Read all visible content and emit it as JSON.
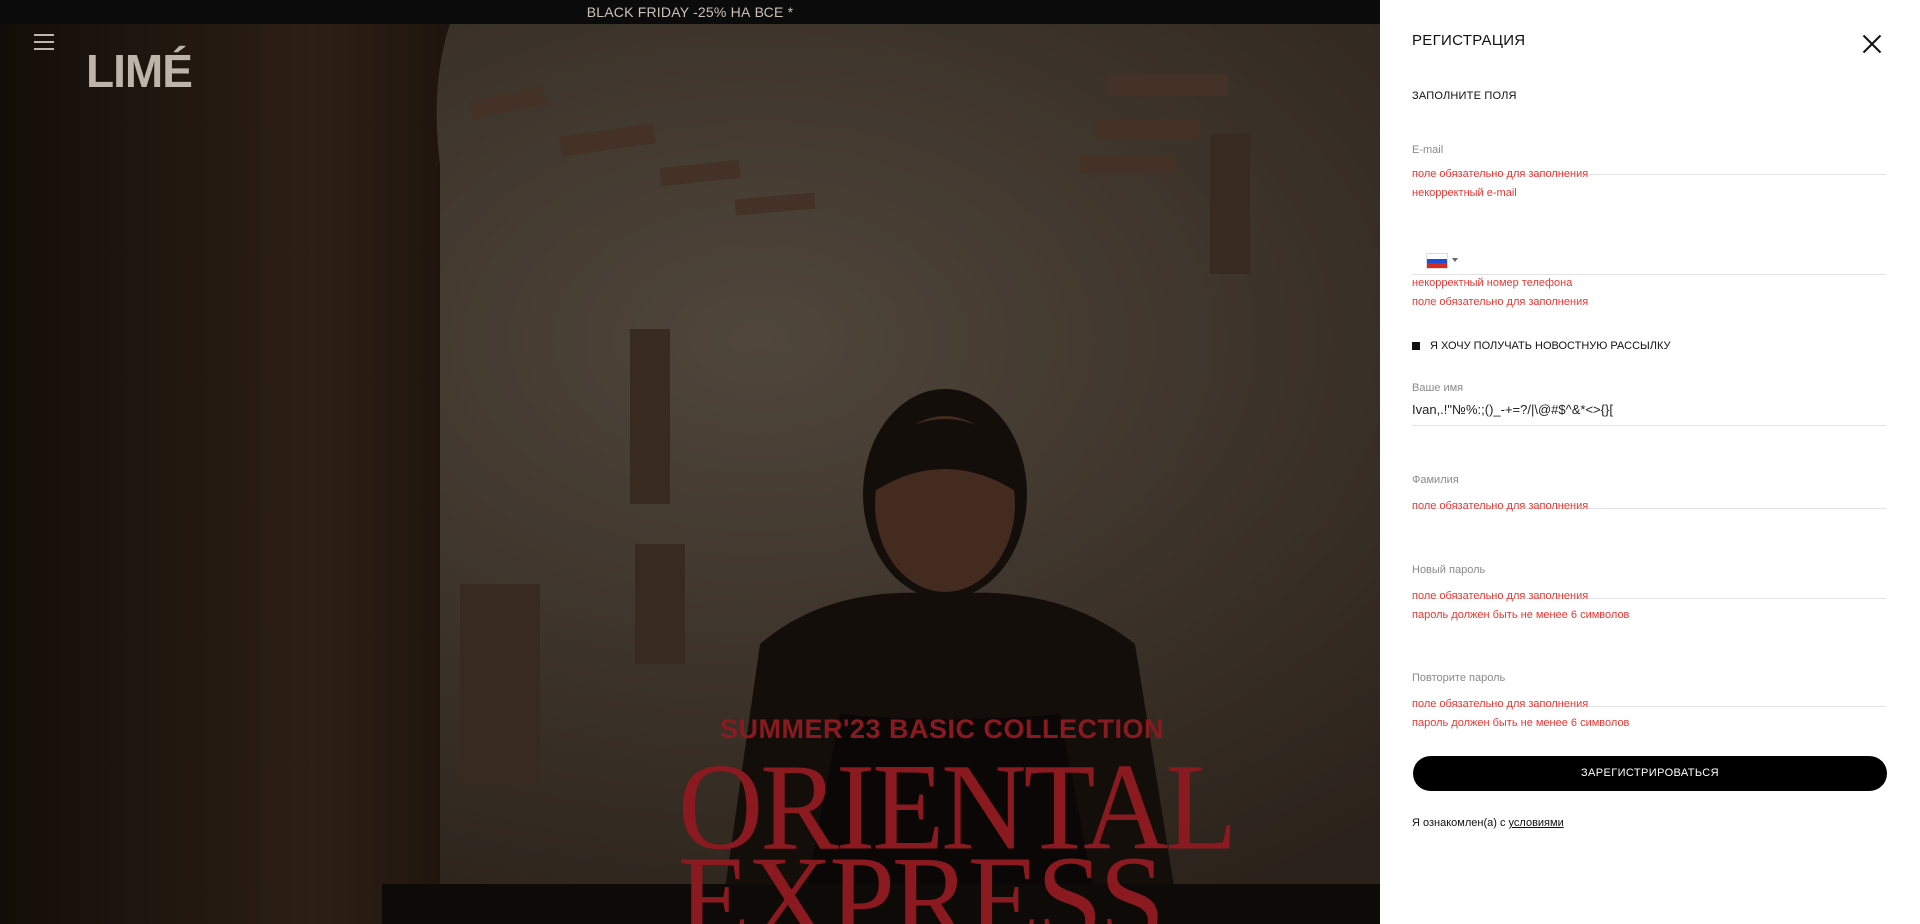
{
  "promo": {
    "text": "BLACK FRIDAY -25% НА ВСЕ *"
  },
  "header": {
    "logo": "LIMÉ"
  },
  "hero": {
    "collection": "SUMMER'23 BASIC COLLECTION",
    "headline_line1": "ORIENTAL",
    "headline_line2": "EXPRESS"
  },
  "form": {
    "title": "РЕГИСТРАЦИЯ",
    "subtitle": "ЗАПОЛНИТЕ ПОЛЯ",
    "email": {
      "label": "E-mail",
      "value": "",
      "errors": [
        "поле обязательно для заполнения",
        "некорректный e-mail"
      ]
    },
    "phone": {
      "value": "",
      "errors": [
        "некорректный номер телефона",
        "поле обязательно для заполнения"
      ]
    },
    "newsletter_label": "Я ХОЧУ ПОЛУЧАТЬ НОВОСТНУЮ РАССЫЛКУ",
    "first_name": {
      "label": "Ваше имя",
      "value": "Ivan,.!\"№%:;()_-+=?/|\\@#$^&*<>{}["
    },
    "last_name": {
      "label": "Фамилия",
      "value": "",
      "errors": [
        "поле обязательно для заполнения"
      ]
    },
    "password": {
      "label": "Новый пароль",
      "value": "",
      "errors": [
        "поле обязательно для заполнения",
        "пароль должен быть не менее 6 символов"
      ]
    },
    "password_repeat": {
      "label": "Повторите пароль",
      "value": "",
      "errors": [
        "поле обязательно для заполнения",
        "пароль должен быть не менее 6 символов"
      ]
    },
    "submit_label": "ЗАРЕГИСТРИРОВАТЬСЯ",
    "agree_text": "Я ознакомлен(а) с",
    "agree_link": "условиями"
  },
  "colors": {
    "error": "#e53935",
    "accent": "#8a1a1f",
    "button": "#000000"
  },
  "icons": [
    "menu-icon",
    "close-icon",
    "russia-flag-icon",
    "chevron-down-icon"
  ]
}
